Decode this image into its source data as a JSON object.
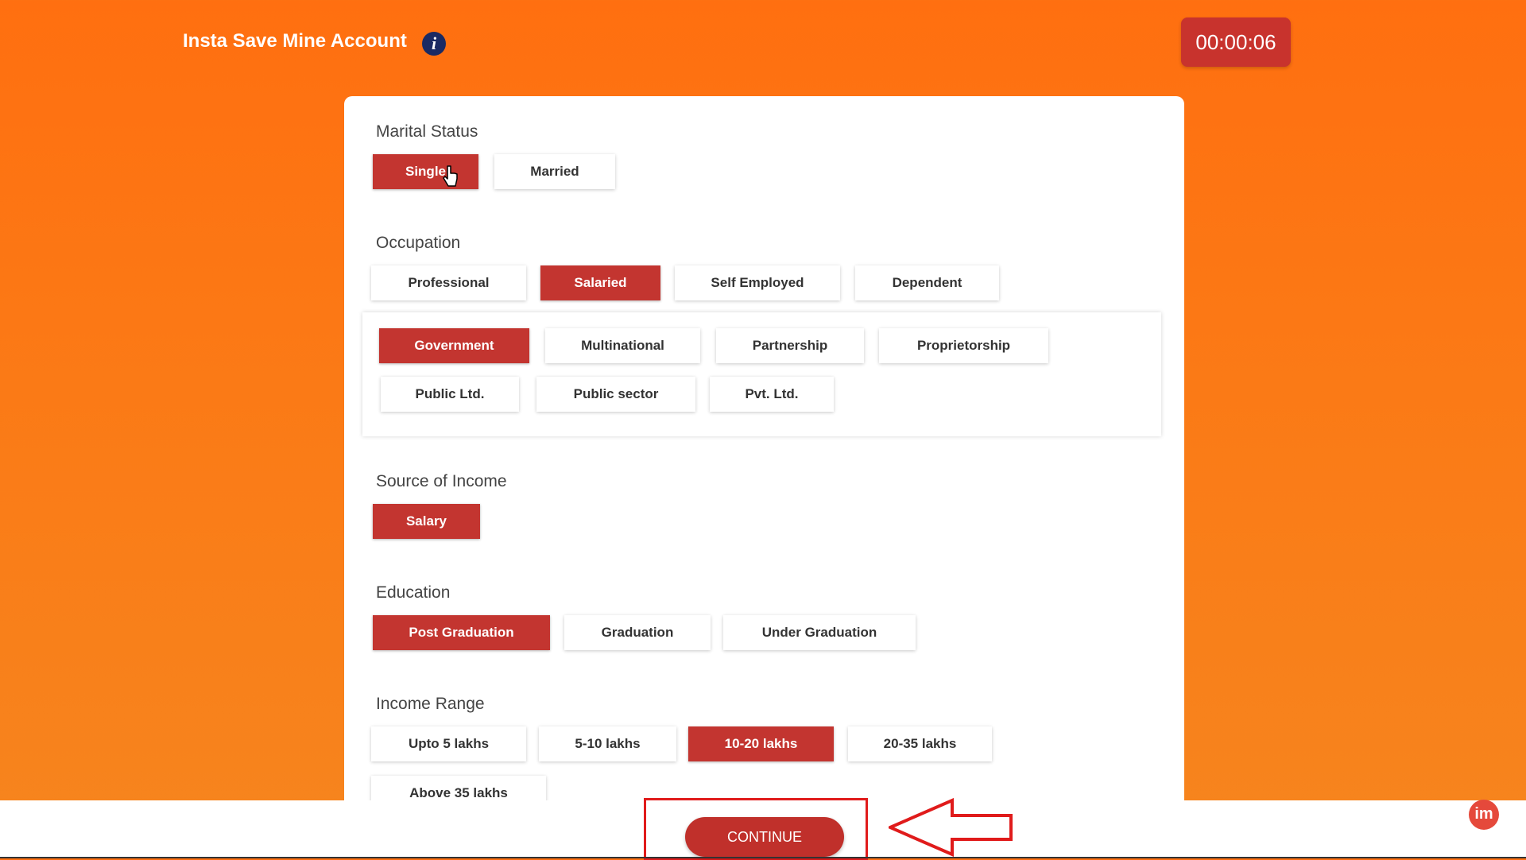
{
  "header": {
    "title": "Insta Save Mine Account",
    "info_icon": "info-icon",
    "timer": "00:00:06"
  },
  "colors": {
    "accent": "#c33530",
    "background": "#ff6f10",
    "arrow": "#e01b1b"
  },
  "sections": {
    "marital": {
      "label": "Marital Status",
      "options": [
        "Single",
        "Married"
      ],
      "selected": "Single"
    },
    "occupation": {
      "label": "Occupation",
      "options": [
        "Professional",
        "Salaried",
        "Self Employed",
        "Dependent"
      ],
      "selected": "Salaried",
      "sub_options": [
        "Government",
        "Multinational",
        "Partnership",
        "Proprietorship",
        "Public Ltd.",
        "Public sector",
        "Pvt. Ltd."
      ],
      "sub_selected": "Government"
    },
    "income_source": {
      "label": "Source of Income",
      "options": [
        "Salary"
      ],
      "selected": "Salary"
    },
    "education": {
      "label": "Education",
      "options": [
        "Post Graduation",
        "Graduation",
        "Under Graduation"
      ],
      "selected": "Post Graduation"
    },
    "income_range": {
      "label": "Income Range",
      "options": [
        "Upto 5 lakhs",
        "5-10 lakhs",
        "10-20 lakhs",
        "20-35 lakhs",
        "Above 35 lakhs"
      ],
      "selected": "10-20 lakhs"
    }
  },
  "footer": {
    "continue_label": "CONTINUE",
    "logo": "im"
  }
}
